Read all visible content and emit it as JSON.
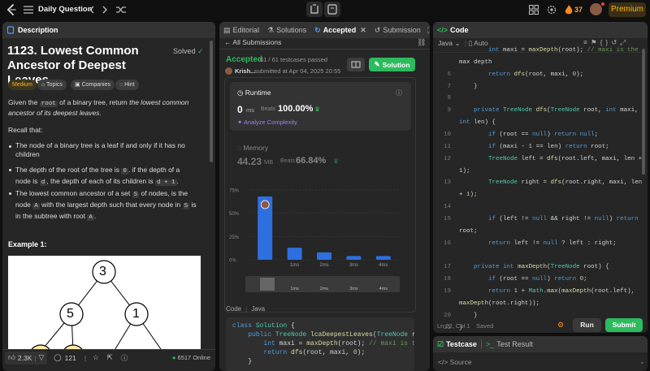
{
  "topbar": {
    "title": "Daily Question",
    "streak": "37",
    "premium": "Premium"
  },
  "desc_panel": {
    "tab": "Description",
    "title": "1123. Lowest Common Ancestor of Deepest Leaves",
    "status": "Solved",
    "tags": [
      "Medium",
      "Topics",
      "Companies",
      "Hint"
    ],
    "intro_pre": "Given the ",
    "intro_code": "root",
    "intro_mid": " of a binary tree, return ",
    "intro_em": "the lowest common ancestor of its deepest leaves.",
    "recall": "Recall that:",
    "b1": "The node of a binary tree is a leaf if and only if it has no children",
    "b2a": "The depth of the root of the tree is ",
    "b2c1": "0",
    "b2b": ". if the depth of a node is ",
    "b2c2": "d",
    "b2c": ", the depth of each of its children is ",
    "b2c3": "d + 1",
    "b3a": "The lowest common ancestor of a set ",
    "b3c1": "S",
    "b3b": " of nodes, is the node ",
    "b3c2": "A",
    "b3c": " with the largest depth such that every node in ",
    "b3c3": "S",
    "b3d": " is in the subtree with root ",
    "b3c4": "A",
    "example": "Example 1:",
    "tree": {
      "root": "3",
      "left": "5",
      "right": "1"
    },
    "likes": "2.3K",
    "comments": "121",
    "online": "6517 Online"
  },
  "sub_panel": {
    "tabs": [
      "Editorial",
      "Solutions",
      "Accepted",
      "Submission"
    ],
    "back": "All Submissions",
    "status": "Accepted",
    "testcases": "61 / 61 testcases passed",
    "user": "Krish...",
    "submitted": "submitted at Apr 04, 2025 20:55",
    "solution_btn": "Solution",
    "runtime_label": "Runtime",
    "runtime_value": "0",
    "runtime_unit": "ms",
    "beats_label": "Beats",
    "runtime_beats": "100.00%",
    "analyze": "Analyze Complexity",
    "memory_label": "Memory",
    "memory_value": "44.23",
    "memory_unit": "MB",
    "memory_beats": "66.84%",
    "code_label": "Code",
    "code_lang": "Java"
  },
  "chart_data": {
    "type": "bar",
    "categories": [
      "0ms",
      "1ms",
      "2ms",
      "3ms",
      "4ms"
    ],
    "values": [
      68,
      13,
      8,
      4,
      4
    ],
    "ylim": [
      0,
      75
    ],
    "yticks": [
      "0%",
      "25%",
      "50%",
      "75%"
    ],
    "highlight_index": 0
  },
  "sub_code": [
    "class Solution {",
    "    public TreeNode lcaDeepestLeaves(TreeNode root)",
    "        int maxi = maxDepth(root); // maxi is the m",
    "        return dfs(root, maxi, 0);",
    "    }"
  ],
  "code_panel": {
    "tab": "Code",
    "lang": "Java",
    "mode": "Auto",
    "status_pos": "Ln 22, Col 1",
    "status_saved": "Saved",
    "run": "Run",
    "submit": "Submit",
    "lines": [
      {
        "n": "",
        "t": "        int maxi = maxDepth(root); // maxi is the"
      },
      {
        "n": "",
        "t": "max depth"
      },
      {
        "n": "6",
        "t": "        return dfs(root, maxi, 0);"
      },
      {
        "n": "7",
        "t": "    }"
      },
      {
        "n": "8",
        "t": ""
      },
      {
        "n": "9",
        "t": "    private TreeNode dfs(TreeNode root, int maxi,"
      },
      {
        "n": "",
        "t": "int len) {"
      },
      {
        "n": "10",
        "t": "        if (root == null) return null;"
      },
      {
        "n": "11",
        "t": "        if (maxi - 1 == len) return root;"
      },
      {
        "n": "12",
        "t": "        TreeNode left = dfs(root.left, maxi, len +"
      },
      {
        "n": "",
        "t": "1);"
      },
      {
        "n": "13",
        "t": "        TreeNode right = dfs(root.right, maxi, len"
      },
      {
        "n": "",
        "t": "+ 1);"
      },
      {
        "n": "14",
        "t": ""
      },
      {
        "n": "15",
        "t": "        if (left != null && right != null) return"
      },
      {
        "n": "",
        "t": "root;"
      },
      {
        "n": "16",
        "t": "        return left != null ? left : right;"
      },
      {
        "n": "",
        "t": ""
      },
      {
        "n": "17",
        "t": "    private int maxDepth(TreeNode root) {"
      },
      {
        "n": "18",
        "t": "        if (root == null) return 0;"
      },
      {
        "n": "19",
        "t": "        return 1 + Math.max(maxDepth(root.left),"
      },
      {
        "n": "",
        "t": "maxDepth(root.right));"
      },
      {
        "n": "20",
        "t": "    }"
      },
      {
        "n": "21",
        "t": "}"
      },
      {
        "n": "22",
        "t": ""
      }
    ]
  },
  "tests_panel": {
    "testcase": "Testcase",
    "result": "Test Result",
    "source": "Source"
  },
  "colors": {
    "accent_green": "#2cbb5d",
    "bar_blue": "#2e6fe0",
    "premium": "#ffb800"
  }
}
